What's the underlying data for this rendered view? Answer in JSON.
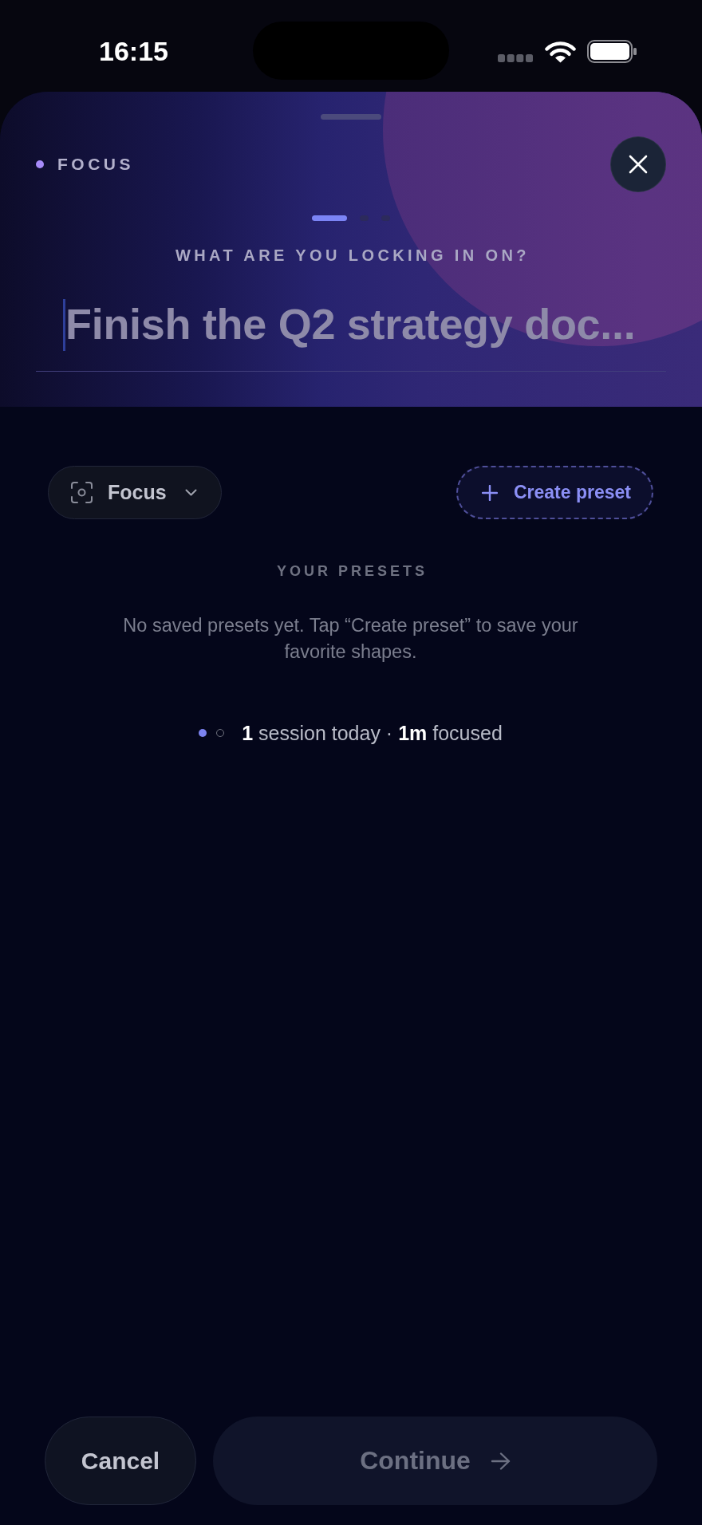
{
  "status_bar": {
    "time": "16:15"
  },
  "sheet": {
    "eyebrow": "FOCUS",
    "steps": [
      {
        "selected": true
      },
      {
        "selected": false
      },
      {
        "selected": false
      }
    ],
    "prompt": "WHAT ARE YOU LOCKING IN ON?",
    "task_input": {
      "placeholder": "Finish the Q2 strategy doc..."
    }
  },
  "mode_dropdown": {
    "label": "Focus"
  },
  "create_preset_button": {
    "label": "Create preset"
  },
  "presets": {
    "heading": "YOUR PRESETS",
    "empty_message": "No saved presets yet. Tap “Create preset” to save your favorite shapes."
  },
  "session_summary": {
    "dots": [
      {
        "filled": true
      },
      {
        "filled": false
      }
    ],
    "text": "**1** session today · **1m** focused"
  },
  "footer": {
    "buttons": [
      {
        "kind": "secondary",
        "label": "Cancel",
        "disabled": false
      },
      {
        "kind": "primary",
        "label": "Continue",
        "disabled": true
      }
    ]
  }
}
